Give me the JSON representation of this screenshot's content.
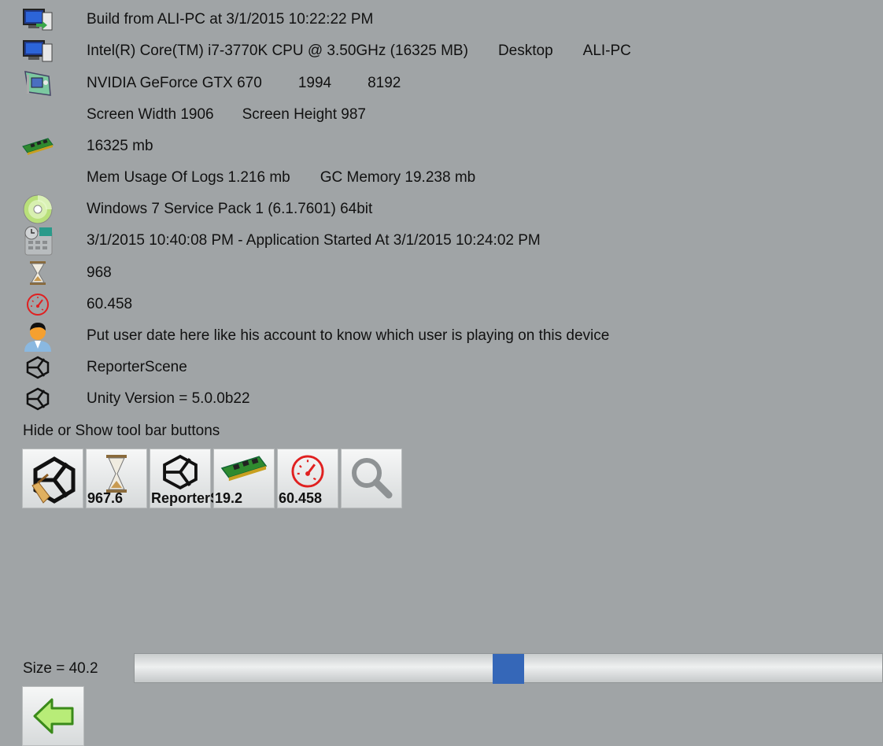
{
  "info": {
    "build": "Build from ALI-PC at 3/1/2015 10:22:22 PM",
    "cpu": "Intel(R) Core(TM) i7-3770K CPU @ 3.50GHz (16325 MB)",
    "device_type": "Desktop",
    "device_name": "ALI-PC",
    "gpu": "NVIDIA GeForce GTX 670",
    "gpu_id": "1994",
    "gpu_mem": "8192",
    "screen_width": "Screen Width 1906",
    "screen_height": "Screen Height 987",
    "ram": "16325 mb",
    "log_mem": "Mem Usage Of Logs 1.216 mb",
    "gc_mem": "GC Memory 19.238 mb",
    "os": "Windows 7 Service Pack 1 (6.1.7601) 64bit",
    "time": "3/1/2015 10:40:08 PM - Application Started At 3/1/2015 10:24:02 PM",
    "frame_count": "968",
    "fps": "60.458",
    "user_data": "Put user date here like his account to know which user is playing on this device",
    "scene": "ReporterScene",
    "unity_version": "Unity Version = 5.0.0b22"
  },
  "toolbar_hint": "Hide or Show tool bar buttons",
  "toolbar": [
    {
      "icon": "unity-clear-icon",
      "label": ""
    },
    {
      "icon": "hourglass-icon",
      "label": "967.6"
    },
    {
      "icon": "unity-icon",
      "label": "ReporterScene"
    },
    {
      "icon": "memory-chip-icon",
      "label": "19.2"
    },
    {
      "icon": "speedometer-icon",
      "label": "60.458"
    },
    {
      "icon": "search-icon",
      "label": ""
    }
  ],
  "size": {
    "label": "Size = 40.2",
    "fraction": 0.5
  },
  "back_button": {
    "icon": "back-arrow-icon"
  },
  "colors": {
    "background": "#a0a4a6",
    "slider_thumb": "#3567b8",
    "speedometer": "#e02020",
    "back_arrow": "#b8ec78"
  }
}
